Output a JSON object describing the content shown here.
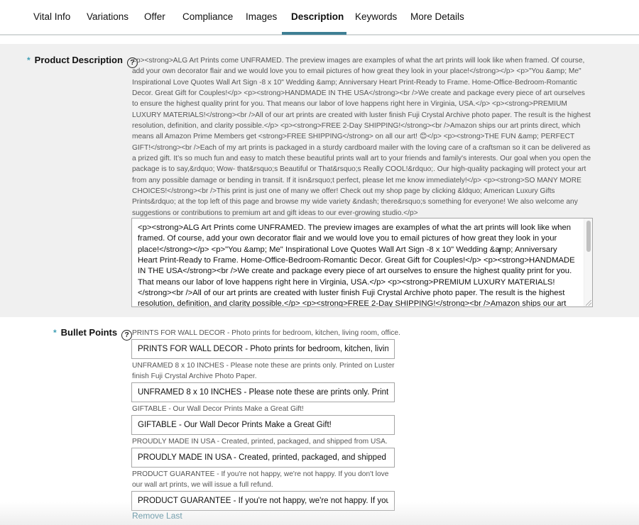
{
  "tabs": [
    {
      "label": "Vital Info",
      "active": false
    },
    {
      "label": "Variations",
      "active": false
    },
    {
      "label": "Offer",
      "active": false
    },
    {
      "label": "Compliance",
      "active": false
    },
    {
      "label": "Images",
      "active": false
    },
    {
      "label": "Description",
      "active": true
    },
    {
      "label": "Keywords",
      "active": false
    },
    {
      "label": "More Details",
      "active": false
    }
  ],
  "colors": {
    "accent": "#3f7f94",
    "required_marker": "#3f9fb5",
    "section_bg": "#f0f0f0"
  },
  "product_description": {
    "required_marker": "*",
    "label": "Product Description",
    "help_icon": "?",
    "preview": "<p><strong>ALG Art Prints come UNFRAMED. The preview images are examples of what the art prints will look like when framed. Of course, add your own decorator flair and we would love you to email pictures of how great they look in your place!</strong></p> <p>\"You &amp; Me\" Inspirational Love Quotes Wall Art Sign -8 x 10\" Wedding &amp; Anniversary Heart Print-Ready to Frame. Home-Office-Bedroom-Romantic Decor. Great Gift for Couples!</p> <p><strong>HANDMADE IN THE USA</strong><br />We create and package every piece of art ourselves to ensure the highest quality print for you. That means our labor of love happens right here in Virginia, USA.</p> <p><strong>PREMIUM LUXURY MATERIALS!</strong><br />All of our art prints are created with luster finish Fuji Crystal Archive photo paper. The result is the highest resolution, definition, and clarity possible.</p> <p><strong>FREE 2-Day SHIPPING!</strong><br />Amazon ships our art prints direct, which means all Amazon Prime Members get <strong>FREE SHIPPING</strong> on all our art! 😊</p> <p><strong>THE FUN &amp; PERFECT GIFT!</strong><br />Each of my art prints is packaged in a sturdy cardboard mailer with the loving care of a craftsman so it can be delivered as a prized gift. It’s so much fun and easy to match these beautiful prints wall art to your friends and family's interests. Our goal when you open the package is to say,&rdquo; Wow- that&rsquo;s Beautiful or That&rsquo;s Really COOL!&rdquo;. Our high-quality packaging will protect your art from any possible damage or bending in transit. If it isn&rsquo;t perfect, please let me know immediately!</p> <p><strong>SO MANY MORE CHOICES!</strong><br />This print is just one of many we offer! Check out my shop page by clicking &ldquo; American Luxury Gifts Prints&rdquo; at the top left of this page and browse my wide variety &ndash; there&rsquo;s something for everyone! We also welcome any suggestions or contributions to premium art and gift ideas to our ever-growing studio.</p>",
    "value": "<p><strong>ALG Art Prints come UNFRAMED. The preview images are examples of what the art prints will look like when framed. Of course, add your own decorator flair and we would love you to email pictures of how great they look in your place!</strong></p> <p>\"You &amp; Me\" Inspirational Love Quotes Wall Art Sign -8 x 10\" Wedding &amp; Anniversary Heart Print-Ready to Frame. Home-Office-Bedroom-Romantic Decor. Great Gift for Couples!</p> <p><strong>HANDMADE IN THE USA</strong><br />We create and package every piece of art ourselves to ensure the highest quality print for you. That means our labor of love happens right here in Virginia, USA.</p> <p><strong>PREMIUM LUXURY MATERIALS!</strong><br />All of our art prints are created with luster finish Fuji Crystal Archive photo paper. The result is the highest resolution, definition, and clarity possible.</p> <p><strong>FREE 2-Day SHIPPING!</strong><br />Amazon ships our art prints direct, which means all Amazon Prime Members get <strong>FREE SHIPPING</strong> on all our art!"
  },
  "bullet_points": {
    "required_marker": "*",
    "label": "Bullet Points",
    "help_icon": "?",
    "items": [
      {
        "hint": "PRINTS FOR WALL DECOR - Photo prints for bedroom, kitchen, living room, office.",
        "value": "PRINTS FOR WALL DECOR - Photo prints for bedroom, kitchen, living room, office."
      },
      {
        "hint": "UNFRAMED 8 x 10 INCHES - Please note these are prints only. Printed on Luster finish Fuji Crystal Archive Photo Paper.",
        "value": "UNFRAMED 8 x 10 INCHES - Please note these are prints only. Printed on Luster finish Fuji Crystal Archive Photo Paper."
      },
      {
        "hint": "GIFTABLE - Our Wall Decor Prints Make a Great Gift!",
        "value": "GIFTABLE - Our Wall Decor Prints Make a Great Gift!"
      },
      {
        "hint": "PROUDLY MADE IN USA - Created, printed, packaged, and shipped from USA.",
        "value": "PROUDLY MADE IN USA - Created, printed, packaged, and shipped from USA."
      },
      {
        "hint": "PRODUCT GUARANTEE - If you're not happy, we're not happy. If you don't love our wall art prints, we will issue a full refund.",
        "value": "PRODUCT GUARANTEE - If you're not happy, we're not happy. If you don't love our wall art prints, we will issue a full refund."
      }
    ],
    "remove_last_label": "Remove Last"
  }
}
